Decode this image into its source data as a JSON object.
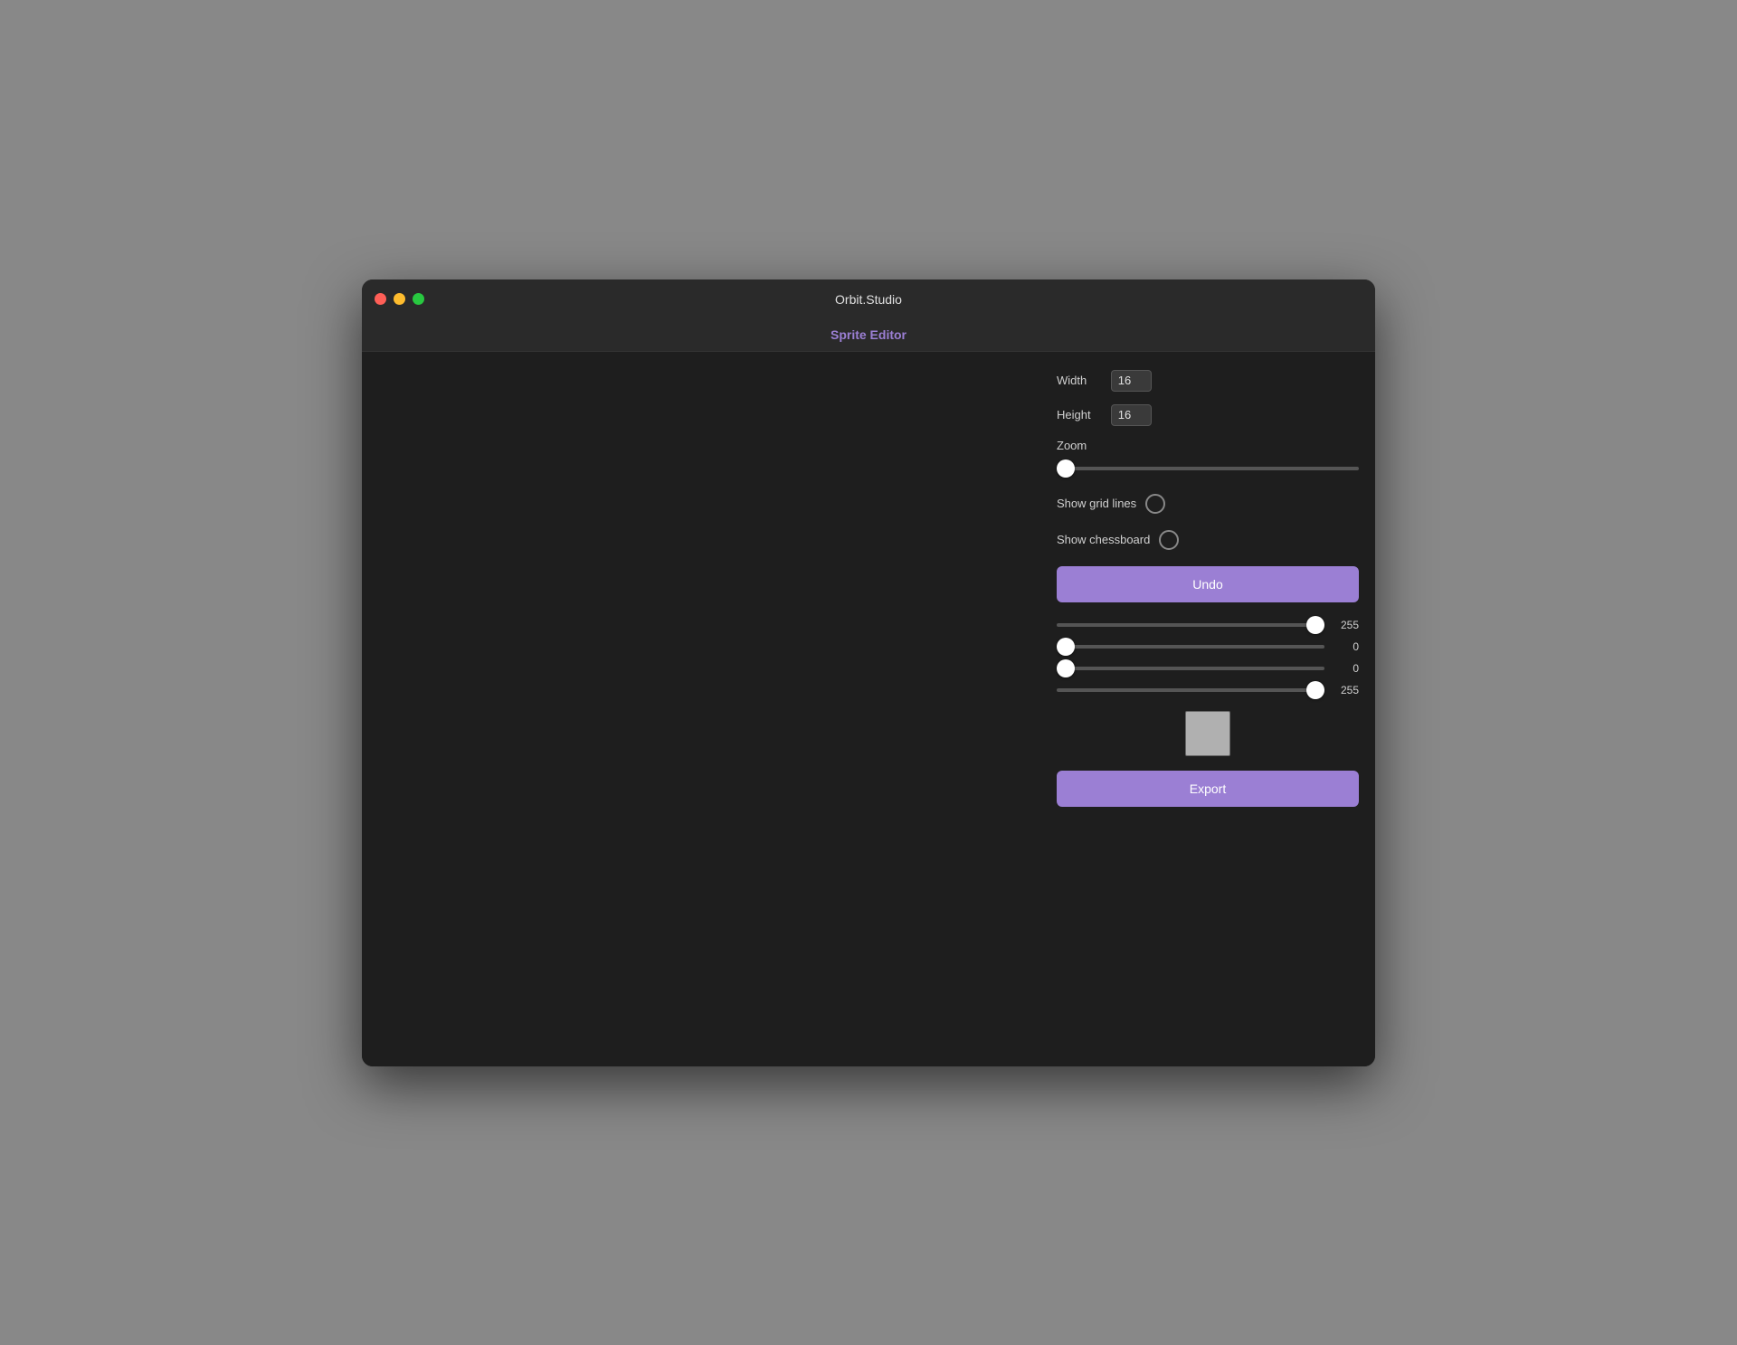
{
  "window": {
    "app_title": "Orbit.Studio",
    "page_title": "Sprite Editor"
  },
  "traffic_lights": {
    "close_label": "close",
    "minimize_label": "minimize",
    "maximize_label": "maximize"
  },
  "controls": {
    "width_label": "Width",
    "width_value": "16",
    "height_label": "Height",
    "height_value": "16",
    "zoom_label": "Zoom",
    "zoom_value": "0",
    "show_grid_lines_label": "Show grid lines",
    "show_chessboard_label": "Show chessboard",
    "undo_label": "Undo",
    "export_label": "Export"
  },
  "color_sliders": [
    {
      "value": "255",
      "slider_value": "255",
      "max": "255"
    },
    {
      "value": "0",
      "slider_value": "0",
      "max": "255"
    },
    {
      "value": "0",
      "slider_value": "0",
      "max": "255"
    },
    {
      "value": "255",
      "slider_value": "255",
      "max": "255"
    }
  ],
  "color_preview": {
    "label": "color-preview"
  }
}
